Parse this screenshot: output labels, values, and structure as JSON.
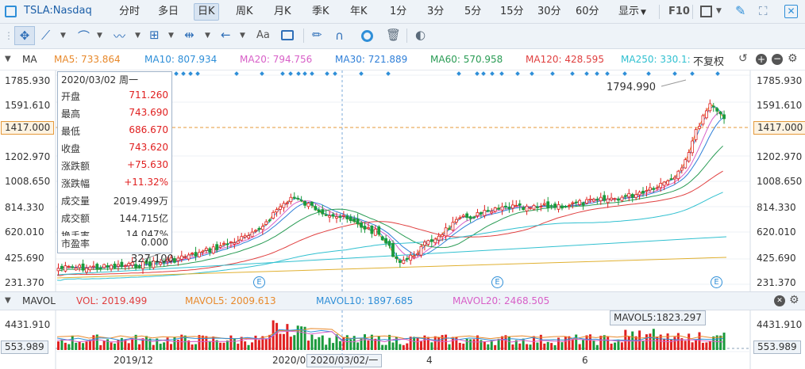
{
  "symbol": "TSLA:Nasdaq",
  "periods": [
    "分时",
    "多日",
    "日K",
    "周K",
    "月K",
    "季K",
    "年K",
    "1分",
    "3分",
    "5分",
    "15分",
    "30分",
    "60分"
  ],
  "active_period": "日K",
  "display_label": "显示",
  "f10_label": "F10",
  "ma_bar": {
    "name": "MA",
    "items": [
      {
        "label": "MA5: 733.864",
        "color": "#e8892b"
      },
      {
        "label": "MA10: 807.934",
        "color": "#2f8fd8"
      },
      {
        "label": "MA20: 794.756",
        "color": "#d860c8"
      },
      {
        "label": "MA30: 721.889",
        "color": "#2f7fd8"
      },
      {
        "label": "MA60: 570.958",
        "color": "#2a9c55"
      },
      {
        "label": "MA120: 428.595",
        "color": "#e04040"
      },
      {
        "label": "MA250: 330.1:",
        "color": "#30c0d0"
      }
    ],
    "adjust": "不复权"
  },
  "price_axis": [
    "1785.930",
    "1591.610",
    "1202.970",
    "1008.650",
    "814.330",
    "620.010",
    "425.690",
    "231.370"
  ],
  "current_price": "1417.000",
  "high_label": "1794.990",
  "low_label": "327.100",
  "info": {
    "date": "2020/03/02 周一",
    "rows": [
      {
        "label": "开盘",
        "value": "711.260",
        "color": "#e02020"
      },
      {
        "label": "最高",
        "value": "743.690",
        "color": "#e02020"
      },
      {
        "label": "最低",
        "value": "686.670",
        "color": "#e02020"
      },
      {
        "label": "收盘",
        "value": "743.620",
        "color": "#e02020"
      },
      {
        "label": "涨跌额",
        "value": "+75.630",
        "color": "#e02020"
      },
      {
        "label": "涨跌幅",
        "value": "+11.32%",
        "color": "#e02020"
      },
      {
        "label": "成交量",
        "value": "2019.499万",
        "color": "#333333"
      },
      {
        "label": "成交额",
        "value": "144.715亿",
        "color": "#333333"
      },
      {
        "label": "换手率",
        "value": "14.047%",
        "color": "#333333"
      },
      {
        "label": "市盈率",
        "value": "0.000",
        "color": "#333333"
      }
    ]
  },
  "vol_bar": {
    "name": "MAVOL",
    "items": [
      {
        "label": "VOL: 2019.499",
        "color": "#e04040"
      },
      {
        "label": "MAVOL5: 2009.613",
        "color": "#e8892b"
      },
      {
        "label": "MAVOL10: 1897.685",
        "color": "#2f8fd8"
      },
      {
        "label": "MAVOL20: 2468.505",
        "color": "#d860c8"
      }
    ]
  },
  "vol_axis_top": "4431.910",
  "vol_current": "553.989",
  "vol_tooltip": "MAVOL5:1823.297",
  "x_labels": [
    "2019/12",
    "2020/0",
    "2020/03/02/一",
    "4",
    "6"
  ],
  "event_marker": "E",
  "colors": {
    "up": "#e02020",
    "down": "#1a9a3c",
    "accent": "#2f8fd8",
    "current": "#e59a3a"
  }
}
